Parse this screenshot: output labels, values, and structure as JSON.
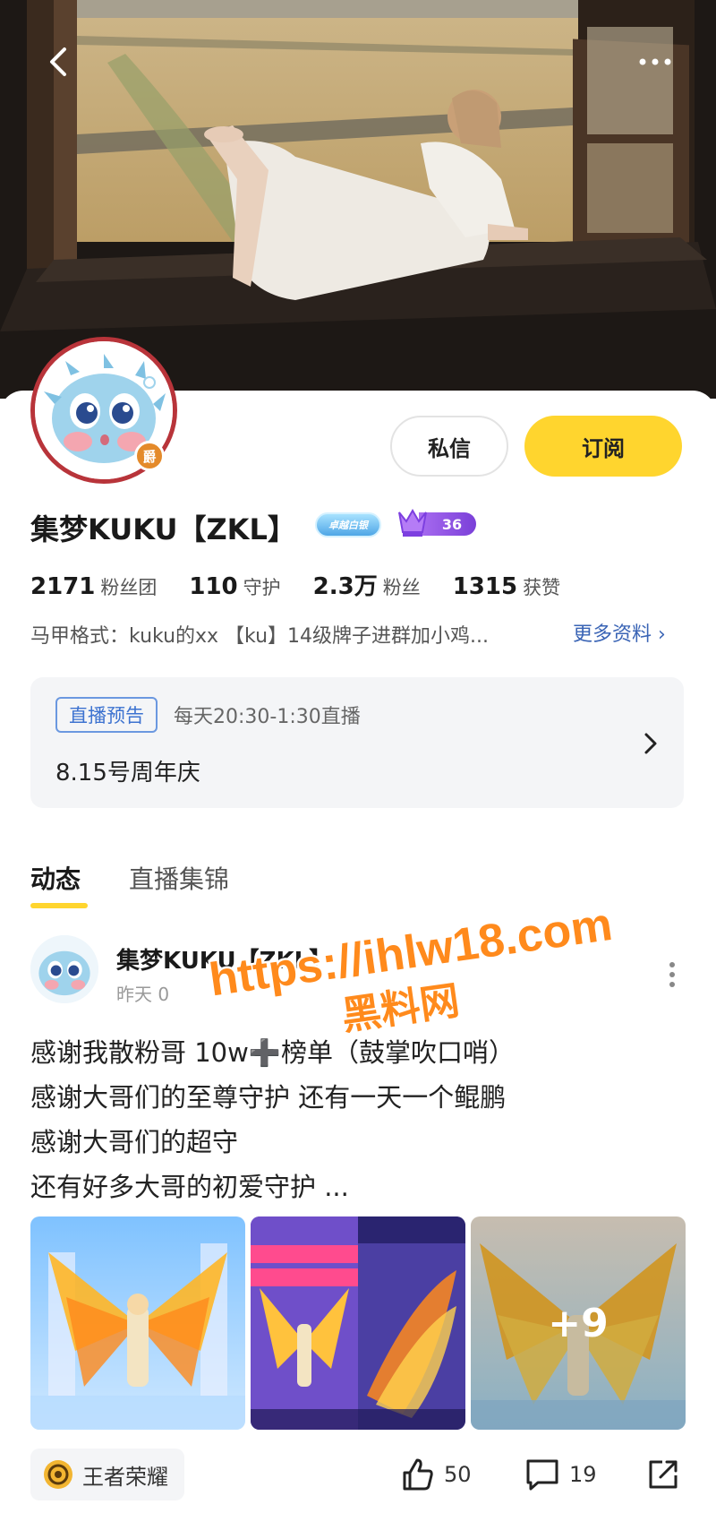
{
  "header": {
    "back_icon": "chevron-left-icon",
    "more_icon": "more-horizontal-icon"
  },
  "profile": {
    "name": "集梦KUKU【ZKL】",
    "avatar_badge": "爵",
    "level_badge_text": "卓越白银",
    "fans_badge_level": "36",
    "actions": {
      "message_label": "私信",
      "subscribe_label": "订阅"
    },
    "stats": [
      {
        "value": "2171",
        "label": "粉丝团"
      },
      {
        "value": "110",
        "label": "守护"
      },
      {
        "value": "2.3万",
        "label": "粉丝"
      },
      {
        "value": "1315",
        "label": "获赞"
      }
    ],
    "bio": "马甲格式：kuku的xx 【ku】14级牌子进群加小鸡...",
    "more_info_label": "更多资料 ›"
  },
  "live_notice": {
    "tag": "直播预告",
    "schedule": "每天20:30-1:30直播",
    "title": "8.15号周年庆"
  },
  "tabs": [
    {
      "label": "动态",
      "active": true
    },
    {
      "label": "直播集锦",
      "active": false
    }
  ],
  "post": {
    "author": "集梦KUKU【ZKL】",
    "time": "昨天 0",
    "lines": [
      "感谢我散粉哥 10w➕榜单（鼓掌吹口哨）",
      "感谢大哥们的至尊守护 还有一天一个鲲鹏",
      "感谢大哥们的超守",
      "还有好多大哥的初爱守护 ..."
    ],
    "extra_images": "+9",
    "game_tag": "王者荣耀",
    "likes": "50",
    "comments": "19"
  },
  "watermark": {
    "url": "https://ihlw18.com",
    "name": "黑料网"
  },
  "colors": {
    "accent_yellow": "#ffd52e",
    "link_blue": "#3a64b5",
    "tag_blue": "#3c72d0",
    "watermark_orange": "#ff8a1c"
  }
}
